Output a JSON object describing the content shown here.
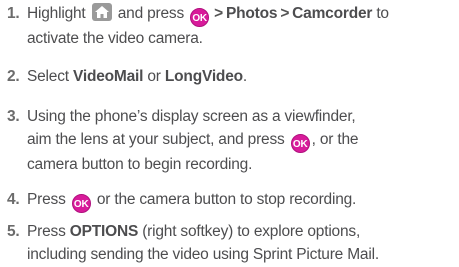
{
  "steps": [
    {
      "number": "1.",
      "t1": "Highlight",
      "t2": "and press",
      "gt1": ">",
      "photos": "Photos",
      "gt2": ">",
      "camcorder": "Camcorder",
      "t3": "to",
      "t4": "activate the video camera."
    },
    {
      "number": "2.",
      "t1": "Select",
      "videomail": "VideoMail",
      "or": "or",
      "longvideo": "LongVideo",
      "period": "."
    },
    {
      "number": "3.",
      "t1": "Using the phone’s display screen as a viewfinder,",
      "t2": "aim the lens at your subject, and press",
      "t3": ", or the",
      "t4": "camera button to begin recording."
    },
    {
      "number": "4.",
      "t1": "Press",
      "t2": "or the camera button to stop recording."
    },
    {
      "number": "5.",
      "t1": "Press",
      "options": "OPTIONS",
      "t2": "(right softkey) to explore options,",
      "t3": "including sending the video using Sprint Picture Mail."
    }
  ],
  "icons": {
    "ok_label": "OK",
    "ok_color": "#d81b9a",
    "home_icon": "home-icon"
  }
}
